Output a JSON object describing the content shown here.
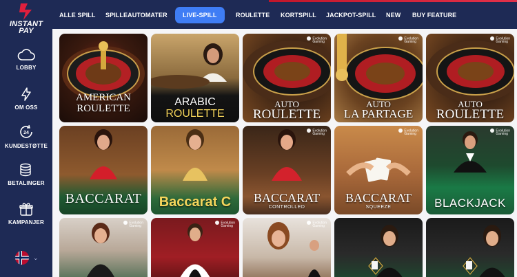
{
  "brand": {
    "line1": "INSTANT",
    "line2": "PAY"
  },
  "sidebar": {
    "items": [
      {
        "label": "LOBBY",
        "icon": "cloud-icon"
      },
      {
        "label": "OM OSS",
        "icon": "lightning-icon"
      },
      {
        "label": "KUNDESTØTTE",
        "icon": "support-24-icon"
      },
      {
        "label": "BETALINGER",
        "icon": "coins-icon"
      },
      {
        "label": "KAMPANJER",
        "icon": "gift-icon"
      }
    ],
    "language": "norwegian-flag-icon"
  },
  "topnav": {
    "tabs": [
      {
        "label": "ALLE SPILL"
      },
      {
        "label": "SPILLEAUTOMATER"
      },
      {
        "label": "LIVE-SPILL",
        "active": true
      },
      {
        "label": "ROULETTE"
      },
      {
        "label": "KORTSPILL"
      },
      {
        "label": "JACKPOT-SPILL"
      },
      {
        "label": "NEW"
      },
      {
        "label": "BUY FEATURE"
      }
    ],
    "accent_color": "#3f7df5"
  },
  "provider": {
    "line1": "Evolution",
    "line2": "Gaming"
  },
  "games": [
    {
      "line1": "AMERICAN",
      "line2": "ROULETTE"
    },
    {
      "line1": "ARABIC",
      "line2": "ROULETTE"
    },
    {
      "line1": "AUTO",
      "line2": "ROULETTE"
    },
    {
      "line1": "AUTO",
      "line2": "LA PARTAGE"
    },
    {
      "line1": "AUTO",
      "line2": "ROULETTE"
    },
    {
      "line1": "BACCARAT",
      "line2": ""
    },
    {
      "line1": "Baccarat C",
      "line2": ""
    },
    {
      "line1": "BACCARAT",
      "line2": "CONTROLLED"
    },
    {
      "line1": "BACCARAT",
      "line2": "SQUEEZE"
    },
    {
      "line1": "BLACKJACK",
      "line2": ""
    },
    {
      "line1": "",
      "line2": ""
    },
    {
      "line1": "",
      "line2": ""
    },
    {
      "line1": "",
      "line2": ""
    },
    {
      "line1": "",
      "line2": ""
    },
    {
      "line1": "",
      "line2": ""
    }
  ]
}
